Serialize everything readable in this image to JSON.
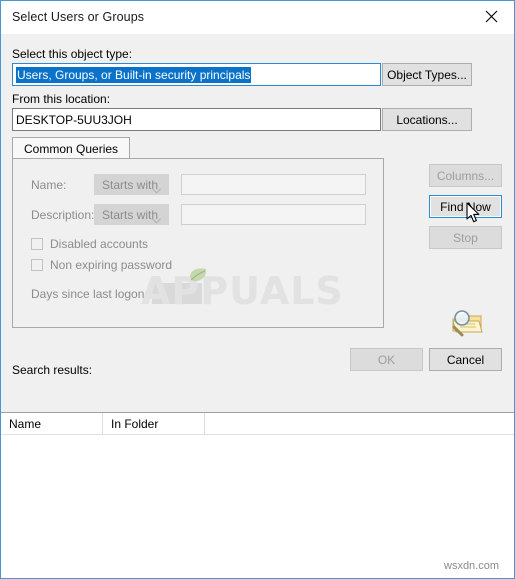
{
  "window": {
    "title": "Select Users or Groups",
    "close_icon": "close-icon"
  },
  "object_type": {
    "label": "Select this object type:",
    "value": "Users, Groups, or Built-in security principals",
    "button_label": "Object Types..."
  },
  "location": {
    "label": "From this location:",
    "value": "DESKTOP-5UU3JOH",
    "button_label": "Locations..."
  },
  "tabs": [
    {
      "label": "Common Queries",
      "selected": true
    }
  ],
  "query": {
    "name_label": "Name:",
    "name_operator": "Starts with",
    "name_value": "",
    "description_label": "Description:",
    "description_operator": "Starts with",
    "description_value": "",
    "disabled_accounts_label": "Disabled accounts",
    "disabled_accounts_checked": false,
    "non_expiring_password_label": "Non expiring password",
    "non_expiring_password_checked": false,
    "days_since_logon_label": "Days since last logon:",
    "days_since_logon_value": ""
  },
  "side_buttons": {
    "columns_label": "Columns...",
    "columns_enabled": false,
    "find_now_label": "Find Now",
    "find_now_enabled": true,
    "stop_label": "Stop",
    "stop_enabled": false
  },
  "results": {
    "label": "Search results:",
    "columns": [
      "Name",
      "In Folder"
    ],
    "rows": []
  },
  "footer": {
    "ok_label": "OK",
    "ok_enabled": false,
    "cancel_label": "Cancel",
    "cancel_enabled": true
  },
  "watermarks": {
    "brand": "APPUALS",
    "site": "wsxdn.com"
  },
  "colors": {
    "accent": "#2a8ad4",
    "selection": "#0a72c8",
    "window_bg": "#f0f0f0",
    "disabled_text": "#8c8c8c"
  }
}
